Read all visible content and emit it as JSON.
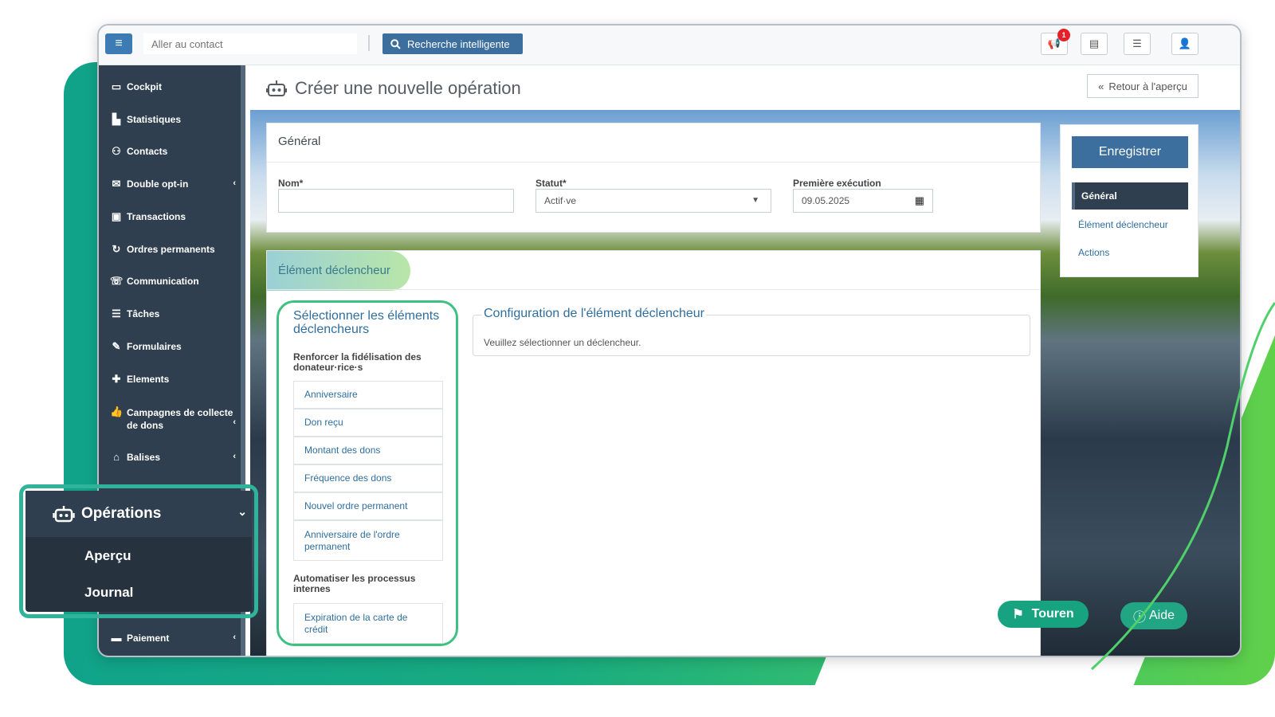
{
  "topbar": {
    "goto_placeholder": "Aller au contact",
    "smart_search_label": "Recherche intelligente",
    "notification_count": "1"
  },
  "sidebar": {
    "items": [
      {
        "label": "Cockpit",
        "icon": "laptop-icon"
      },
      {
        "label": "Statistiques",
        "icon": "chart-icon"
      },
      {
        "label": "Contacts",
        "icon": "users-icon"
      },
      {
        "label": "Double opt-in",
        "icon": "envelope-icon"
      },
      {
        "label": "Transactions",
        "icon": "money-icon"
      },
      {
        "label": "Ordres permanents",
        "icon": "recurring-icon"
      },
      {
        "label": "Communication",
        "icon": "comments-icon"
      },
      {
        "label": "Tâches",
        "icon": "tasks-icon"
      },
      {
        "label": "Formulaires",
        "icon": "edit-icon"
      },
      {
        "label": "Elements",
        "icon": "puzzle-icon"
      },
      {
        "label": "Campagnes de collecte de dons",
        "icon": "thumbs-up-icon"
      },
      {
        "label": "Balises",
        "icon": "tags-icon"
      },
      {
        "label": "Paiement",
        "icon": "credit-card-icon"
      }
    ]
  },
  "page": {
    "title": "Créer une nouvelle opération",
    "back_label": "Retour à l'aperçu"
  },
  "general": {
    "title": "Général",
    "name_label": "Nom*",
    "name_value": "",
    "status_label": "Statut*",
    "status_value": "Actif·ve",
    "first_exec_label": "Première exécution",
    "first_exec_value": "09.05.2025"
  },
  "trigger": {
    "title": "Élément déclencheur",
    "select_title": "Sélectionner les éléments déclencheurs",
    "group1": "Renforcer la fidélisation des donateur·rice·s",
    "group1_items": [
      "Anniversaire",
      "Don reçu",
      "Montant des dons",
      "Fréquence des dons",
      "Nouvel ordre permanent",
      "Anniversaire de l'ordre permanent"
    ],
    "group2": "Automatiser les processus internes",
    "group2_items": [
      "Expiration de la carte de crédit"
    ],
    "config_title": "Configuration de l'élément déclencheur",
    "config_message": "Veuillez sélectionner un déclencheur."
  },
  "right_panel": {
    "save_label": "Enregistrer",
    "nav": [
      "Général",
      "Élément déclencheur",
      "Actions"
    ]
  },
  "floating": {
    "touren_label": "Touren",
    "aide_label": "Aide"
  },
  "operations_menu": {
    "title": "Opérations",
    "items": [
      "Aperçu",
      "Journal"
    ]
  },
  "colors": {
    "sidebar": "#2f3f4f",
    "primary": "#3c6f9e",
    "accent_green": "#17a37f",
    "link": "#2f6e9e",
    "badge": "#e5202a"
  }
}
